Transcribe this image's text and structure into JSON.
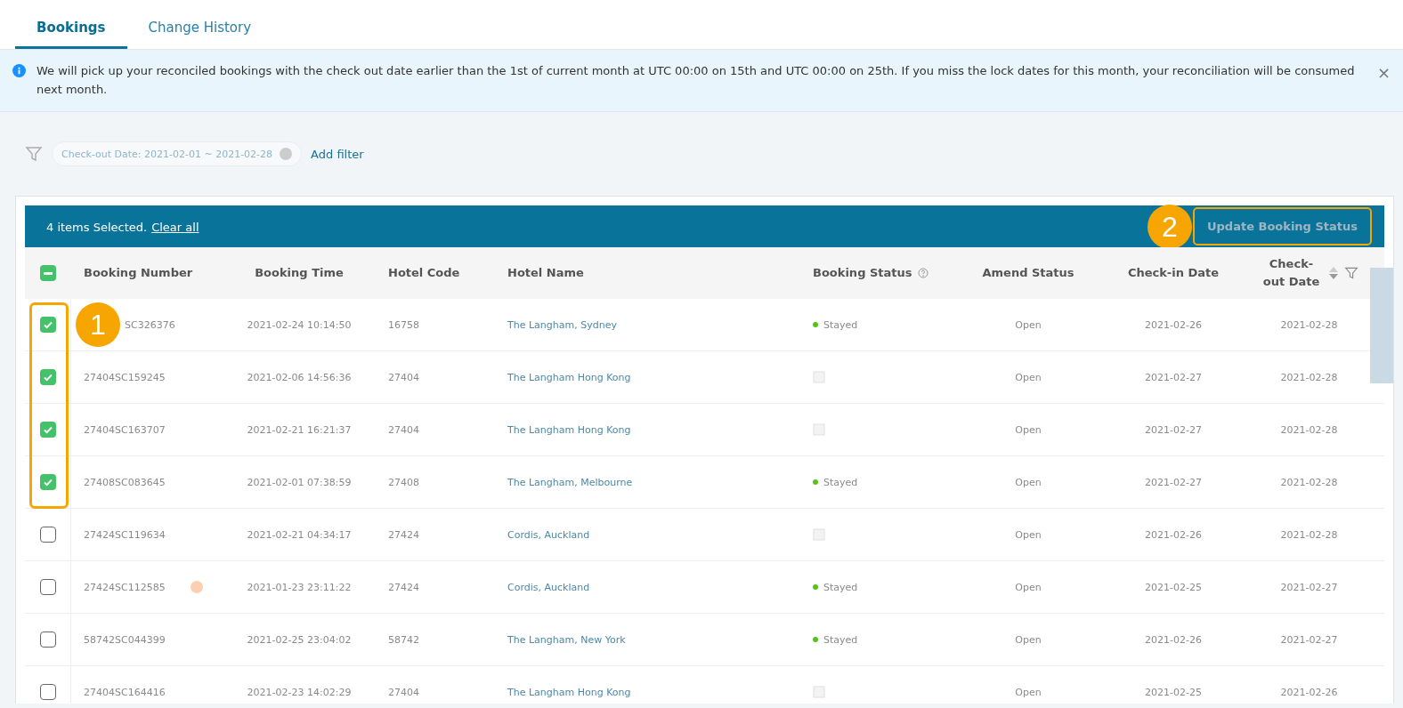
{
  "tabs": [
    {
      "label": "Bookings",
      "selected": true
    },
    {
      "label": "Change History",
      "selected": false
    }
  ],
  "banner": {
    "text": "We will pick up your reconciled bookings with the check out date earlier than the 1st of current month at UTC 00:00 on 15th and UTC 00:00 on 25th. If you miss the lock dates for this month, your reconciliation will be consumed next month.",
    "close": "×"
  },
  "filters": {
    "chips": [
      "Check-out Date: 2021-02-01 ~ 2021-02-28"
    ],
    "add_label": "Add filter"
  },
  "selection_bar": {
    "text": "4 items Selected.",
    "clear_label": "Clear all",
    "action": "Update Booking Status"
  },
  "table": {
    "header_indeterminate": true,
    "columns": [
      {
        "label": "Booking Number"
      },
      {
        "label": "Booking Time"
      },
      {
        "label": "Hotel Code"
      },
      {
        "label": "Hotel Name"
      },
      {
        "label": "Booking Status",
        "help": true
      },
      {
        "label": "Amend Status"
      },
      {
        "label": "Check-in Date"
      },
      {
        "label": "Check-out Date",
        "sortable": true,
        "filterable": true
      }
    ],
    "rows": [
      {
        "checked": true,
        "number": "SC326376",
        "flag": false,
        "time": "2021-02-24 10:14:50",
        "code": "16758",
        "hotel": "The Langham, Sydney",
        "status": {
          "kind": "stayed",
          "label": "Stayed",
          "color": "#52c41a"
        },
        "amend": "Open",
        "checkin": "2021-02-26",
        "checkout": "2021-02-28"
      },
      {
        "checked": true,
        "number": "27404SC159245",
        "flag": false,
        "time": "2021-02-06 14:56:36",
        "code": "27404",
        "hotel": "The Langham Hong Kong",
        "status": {
          "kind": "empty"
        },
        "amend": "Open",
        "checkin": "2021-02-27",
        "checkout": "2021-02-28"
      },
      {
        "checked": true,
        "number": "27404SC163707",
        "flag": false,
        "time": "2021-02-21 16:21:37",
        "code": "27404",
        "hotel": "The Langham Hong Kong",
        "status": {
          "kind": "empty"
        },
        "amend": "Open",
        "checkin": "2021-02-27",
        "checkout": "2021-02-28"
      },
      {
        "checked": true,
        "number": "27408SC083645",
        "flag": false,
        "time": "2021-02-01 07:38:59",
        "code": "27408",
        "hotel": "The Langham, Melbourne",
        "status": {
          "kind": "stayed",
          "label": "Stayed",
          "color": "#52c41a"
        },
        "amend": "Open",
        "checkin": "2021-02-27",
        "checkout": "2021-02-28"
      },
      {
        "checked": false,
        "number": "27424SC119634",
        "flag": false,
        "time": "2021-02-21 04:34:17",
        "code": "27424",
        "hotel": "Cordis, Auckland",
        "status": {
          "kind": "empty"
        },
        "amend": "Open",
        "checkin": "2021-02-26",
        "checkout": "2021-02-28"
      },
      {
        "checked": false,
        "number": "27424SC112585",
        "flag": true,
        "time": "2021-01-23 23:11:22",
        "code": "27424",
        "hotel": "Cordis, Auckland",
        "status": {
          "kind": "stayed",
          "label": "Stayed",
          "color": "#52c41a"
        },
        "amend": "Open",
        "checkin": "2021-02-25",
        "checkout": "2021-02-27"
      },
      {
        "checked": false,
        "number": "58742SC044399",
        "flag": false,
        "time": "2021-02-25 23:04:02",
        "code": "58742",
        "hotel": "The Langham, New York",
        "status": {
          "kind": "stayed",
          "label": "Stayed",
          "color": "#52c41a"
        },
        "amend": "Open",
        "checkin": "2021-02-26",
        "checkout": "2021-02-27"
      },
      {
        "checked": false,
        "number": "27404SC164416",
        "flag": false,
        "time": "2021-02-23 14:02:29",
        "code": "27404",
        "hotel": "The Langham Hong Kong",
        "status": {
          "kind": "empty"
        },
        "amend": "Open",
        "checkin": "2021-02-25",
        "checkout": "2021-02-26"
      }
    ]
  },
  "annotations": [
    {
      "label": "1"
    },
    {
      "label": "2"
    }
  ]
}
